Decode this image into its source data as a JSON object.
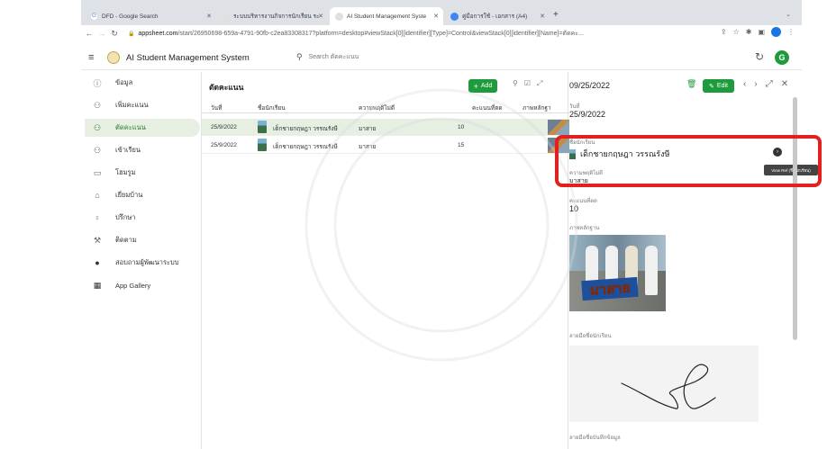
{
  "browser": {
    "tabs": [
      {
        "title": "DFD - Google Search",
        "favicon": "google-icon"
      },
      {
        "title": "ระบบบริหารงานกิจการนักเรียน ระ",
        "favicon": "appsheet-icon"
      },
      {
        "title": "AI Student Management Syste",
        "favicon": "appsheet-icon",
        "active": true
      },
      {
        "title": "คู่มือการใช้ - เอกสาร (A4)",
        "favicon": "docs-icon"
      }
    ],
    "url_host": "appsheet.com",
    "url_rest": "/start/26950698-659a-4791-90fb-c2ea83308317?platform=desktop#viewStack[0][identifier][Type]=Control&viewStack[0][identifier][Name]=ตัดคะ..."
  },
  "app": {
    "title": "AI Student Management System",
    "search_placeholder": "Search ตัดคะแนน",
    "avatar_letter": "G",
    "brand_color": "#1e9b3c"
  },
  "sidebar": {
    "items": [
      {
        "label": "ข้อมูล",
        "icon": "info-circle-icon"
      },
      {
        "label": "เพิ่มคะแนน",
        "icon": "person-add-icon"
      },
      {
        "label": "ตัดคะแนน",
        "icon": "person-remove-icon",
        "active": true
      },
      {
        "label": "เข้าเรียน",
        "icon": "person-check-icon"
      },
      {
        "label": "โฮมรูม",
        "icon": "classroom-icon"
      },
      {
        "label": "เยี่ยมบ้าน",
        "icon": "home-visit-icon"
      },
      {
        "label": "ปรึกษา",
        "icon": "consult-icon"
      },
      {
        "label": "ติดตาม",
        "icon": "follow-icon"
      },
      {
        "label": "สอบถามผู้พัฒนาระบบ",
        "icon": "info-filled-icon"
      },
      {
        "label": "App Gallery",
        "icon": "grid-icon"
      }
    ]
  },
  "table": {
    "title": "ตัดคะแนน",
    "add_label": "Add",
    "columns": [
      "วันที่",
      "ชื่อนักเรียน",
      "ความพฤติไม่ดี",
      "คะแนนที่ตด",
      "ภาพหลักฐา"
    ],
    "rows": [
      {
        "date": "25/9/2022",
        "student": "เด็กชายกฤษฎา วรรณรังษี",
        "behavior": "มาสาย",
        "points": "10"
      },
      {
        "date": "25/9/2022",
        "student": "เด็กชายกฤษฎา วรรณรังษี",
        "behavior": "มาสาย",
        "points": "15"
      }
    ]
  },
  "detail": {
    "header_date": "09/25/2022",
    "edit_label": "Edit",
    "date_label": "วันที่",
    "date_value": "25/9/2022",
    "student_label": "ชื่อนักเรียน",
    "student_value": "เด็กชายกฤษฎา  วรรณรังษี",
    "tooltip": "View Ref (ชื่อนักเรียน)",
    "behavior_label": "ความพฤติไม่ดี",
    "behavior_value": "มาสาย",
    "points_label": "คะแนนที่ตด",
    "points_value": "10",
    "evidence_label": "ภาพหลักฐาน",
    "evidence_caption": "มาสาย",
    "student_sign_label": "ลายมือชื่อนักเรียน",
    "recorder_sign_label": "ลายมือชื่อบันทึกข้อมูล"
  }
}
